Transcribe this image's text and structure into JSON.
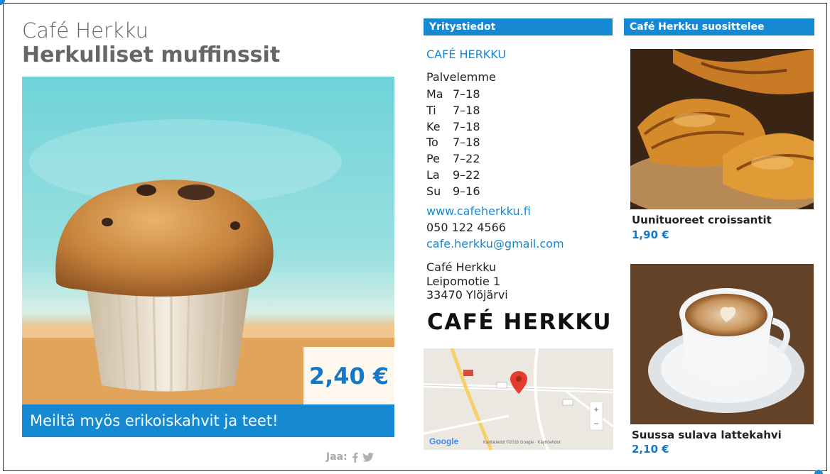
{
  "header": {
    "cafe_name": "Café Herkku",
    "headline": "Herkulliset muffinssit"
  },
  "hero": {
    "image_icon": "muffin-photo",
    "price": "2,40 €",
    "caption": "Meiltä myös erikoiskahvit ja teet!"
  },
  "share": {
    "label": "Jaa:",
    "icons": [
      "facebook-icon",
      "twitter-icon"
    ]
  },
  "company": {
    "section_title": "Yritystiedot",
    "name": "CAFÉ HERKKU",
    "serve_label": "Palvelemme",
    "hours": [
      {
        "day": "Ma",
        "time": "7–18"
      },
      {
        "day": "Ti",
        "time": "7–18"
      },
      {
        "day": "Ke",
        "time": "7–18"
      },
      {
        "day": "To",
        "time": "7–18"
      },
      {
        "day": "Pe",
        "time": "7–22"
      },
      {
        "day": "La",
        "time": "9–22"
      },
      {
        "day": "Su",
        "time": "9–16"
      }
    ],
    "website": "www.cafeherkku.fi",
    "phone": "050 122 4566",
    "email": "cafe.herkku@gmail.com",
    "address_name": "Café Herkku",
    "street": "Leipomotie 1",
    "postal": "33470 Ylöjärvi",
    "logo_text": "CAFÉ HERKKU"
  },
  "map": {
    "provider": "Google",
    "attribution": "Karttatiedot ©2016 Google · Käyttöehdot"
  },
  "recommendations": {
    "section_title": "Café Herkku suosittelee",
    "items": [
      {
        "title": "Uunituoreet croissantit",
        "price": "1,90 €",
        "image": "croissant-photo"
      },
      {
        "title": "Suussa sulava lattekahvi",
        "price": "2,10 €",
        "image": "latte-photo"
      }
    ]
  },
  "colors": {
    "accent": "#1689d3",
    "price": "#1478c8",
    "muted": "#666666"
  }
}
